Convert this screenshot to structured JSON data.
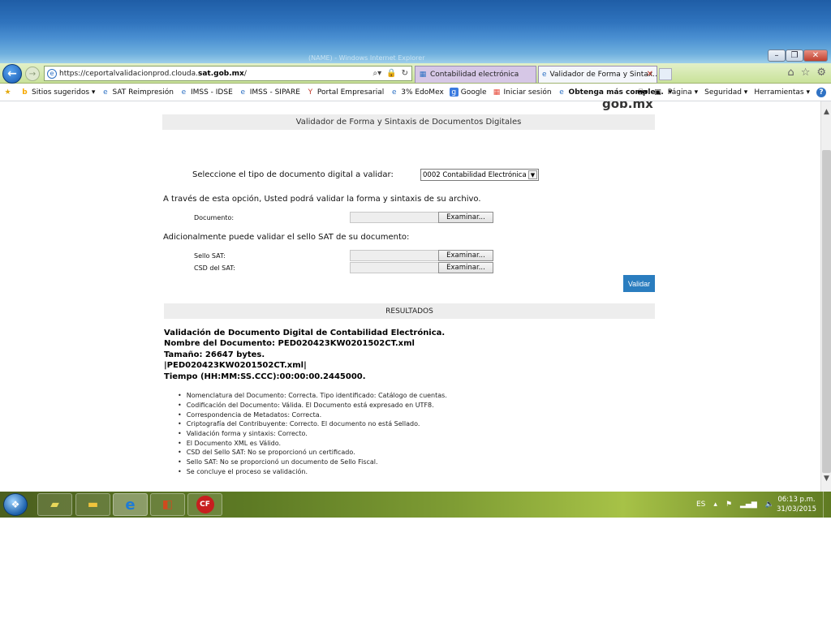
{
  "browser": {
    "titlebar_faint_text": "(NAME) - Windows Internet Explorer",
    "url_prefix": "https://ceportalvalidacionprod.clouda.",
    "url_domain": "sat.gob.mx",
    "url_suffix": "/",
    "tabs": [
      {
        "label": "Contabilidad electrónica"
      },
      {
        "label": "Validador de Forma y Sintax..."
      }
    ],
    "favorites": [
      {
        "label": "Sitios sugeridos ▾"
      },
      {
        "label": "SAT Reimpresión"
      },
      {
        "label": "IMSS - IDSE"
      },
      {
        "label": "IMSS - SIPARE"
      },
      {
        "label": "Portal Empresarial"
      },
      {
        "label": "3% EdoMex"
      },
      {
        "label": "Google"
      },
      {
        "label": "Iniciar sesión"
      },
      {
        "label": "Obtenga más comple..."
      }
    ],
    "commands": {
      "page": "Página ▾",
      "security": "Seguridad ▾",
      "tools": "Herramientas ▾"
    }
  },
  "page": {
    "logo": "gob.mx",
    "header_title": "Validador de Forma y Sintaxis de Documentos Digitales",
    "select_label": "Seleccione el tipo de documento digital a validar:",
    "select_value": "0002 Contabilidad Electrónica",
    "instructions": "A través de esta opción, Usted podrá validar la forma y sintaxis de su archivo.",
    "document_label": "Documento:",
    "browse_label": "Examinar...",
    "seal_intro": "Adicionalmente puede validar el sello SAT de su documento:",
    "seal_label": "Sello SAT:",
    "csd_label": "CSD del SAT:",
    "validate_label": "Validar",
    "results_title": "RESULTADOS",
    "results_lines": [
      "Validación de Documento Digital de Contabilidad Electrónica.",
      "Nombre del Documento: PED020423KW0201502CT.xml",
      "Tamaño: 26647 bytes.",
      "|PED020423KW0201502CT.xml|",
      "Tiempo (HH:MM:SS.CCC):00:00:00.2445000."
    ],
    "checks": [
      "Nomenclatura del Documento: Correcta. Tipo identificado: Catálogo de cuentas.",
      "Codificación del Documento: Válida. El Documento está expresado en UTF8.",
      "Correspondencia de Metadatos: Correcta.",
      "Criptografía del Contribuyente: Correcto. El documento no está Sellado.",
      "Validación forma y sintaxis: Correcto.",
      "El Documento XML es Válido.",
      "CSD del Sello SAT: No se proporcionó un certificado.",
      "Sello SAT: No se proporcionó un documento de Sello Fiscal.",
      "Se concluye el proceso se validación."
    ]
  },
  "taskbar": {
    "language": "ES",
    "time": "06:13 p.m.",
    "date": "31/03/2015"
  },
  "colors": {
    "accent_button": "#2a7dbf",
    "band_gray": "#ededed"
  }
}
